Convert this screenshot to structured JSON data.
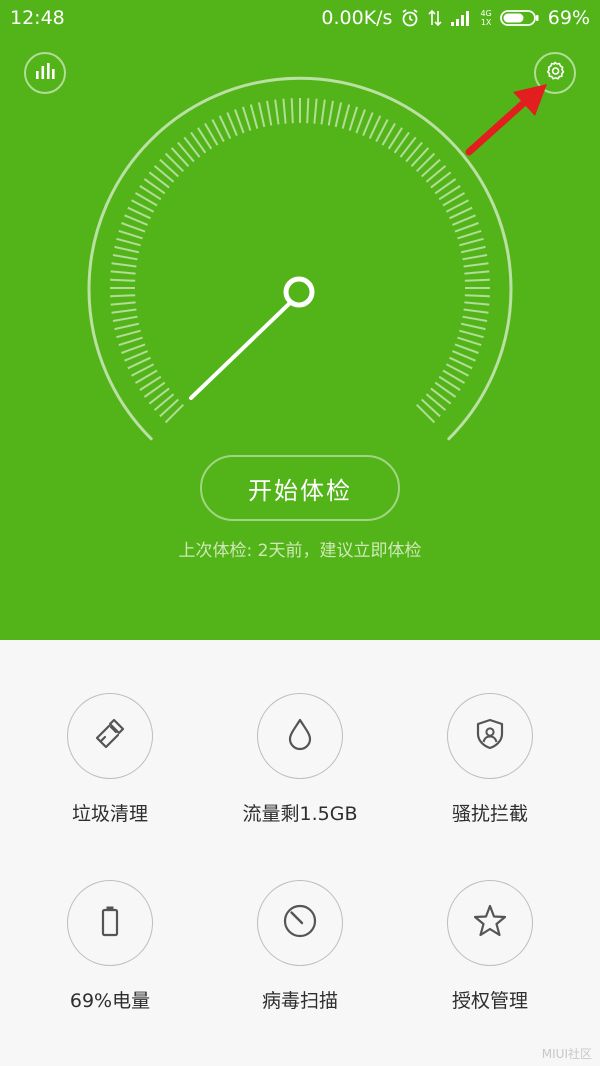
{
  "status_bar": {
    "time": "12:48",
    "net_speed": "0.00K/s",
    "network_type_top": "4G",
    "network_type_bottom": "1X",
    "battery_percent": "69%",
    "battery_level": 0.69,
    "icons": [
      "alarm-icon",
      "data-transfer-icon",
      "signal-icon",
      "battery-icon"
    ]
  },
  "header": {
    "stats_icon": "bar-chart-icon",
    "settings_icon": "gear-icon"
  },
  "scan": {
    "start_label": "开始体检",
    "hint": "上次体检: 2天前，建议立即体检"
  },
  "tools": [
    {
      "label": "垃圾清理",
      "icon": "broom-icon"
    },
    {
      "label": "流量剩1.5GB",
      "icon": "droplet-icon"
    },
    {
      "label": "骚扰拦截",
      "icon": "shield-user-icon"
    },
    {
      "label": "69%电量",
      "icon": "battery-icon"
    },
    {
      "label": "病毒扫描",
      "icon": "scan-dial-icon"
    },
    {
      "label": "授权管理",
      "icon": "star-icon"
    }
  ],
  "colors": {
    "primary_green": "#53b41a",
    "arrow_red": "#e21e1e",
    "panel_bg": "#f7f7f7",
    "icon_gray": "#555555"
  },
  "watermark": "MIUI社区"
}
